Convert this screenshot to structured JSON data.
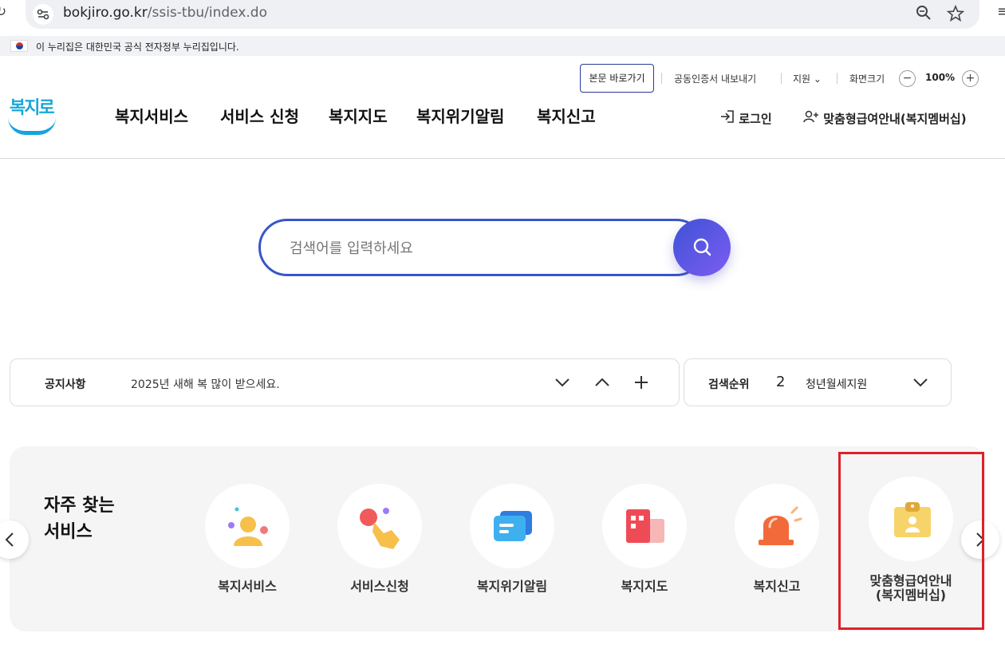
{
  "browser": {
    "url_domain": "bokjiro.go.kr",
    "url_path": "/ssis-tbu/index.do"
  },
  "gov_banner": {
    "text": "이 누리집은 대한민국 공식 전자정부 누리집입니다."
  },
  "utility": {
    "skip_label": "본문 바로가기",
    "cert_label": "공동인증서 내보내기",
    "support_label": "지원",
    "zoom_label": "화면크기",
    "zoom_value": "100%"
  },
  "logo": {
    "text": "복지로"
  },
  "gnb": [
    "복지서비스",
    "서비스 신청",
    "복지지도",
    "복지위기알림",
    "복지신고"
  ],
  "header_actions": {
    "login_label": "로그인",
    "member_label": "맞춤형급여안내(복지멤버십)"
  },
  "search": {
    "placeholder": "검색어를 입력하세요"
  },
  "notice": {
    "title": "공지사항",
    "text": "2025년 새해 복 많이 받으세요."
  },
  "rank": {
    "title": "검색순위",
    "number": "2",
    "text": "청년월세지원"
  },
  "services": {
    "heading_line1": "자주 찾는",
    "heading_line2": "서비스",
    "items": [
      {
        "label": "복지서비스",
        "icon": "person-icon"
      },
      {
        "label": "서비스신청",
        "icon": "hand-tap-icon"
      },
      {
        "label": "복지위기알림",
        "icon": "message-icon"
      },
      {
        "label": "복지지도",
        "icon": "map-building-icon"
      },
      {
        "label": "복지신고",
        "icon": "siren-icon"
      },
      {
        "label_line1": "맞춤형급여안내",
        "label_line2": "(복지멤버십)",
        "icon": "id-card-icon"
      }
    ]
  },
  "colors": {
    "brand_blue": "#3a55c8",
    "search_gradient_start": "#3f52d6",
    "search_gradient_end": "#7c5cf2",
    "highlight_red": "#e0202a"
  }
}
